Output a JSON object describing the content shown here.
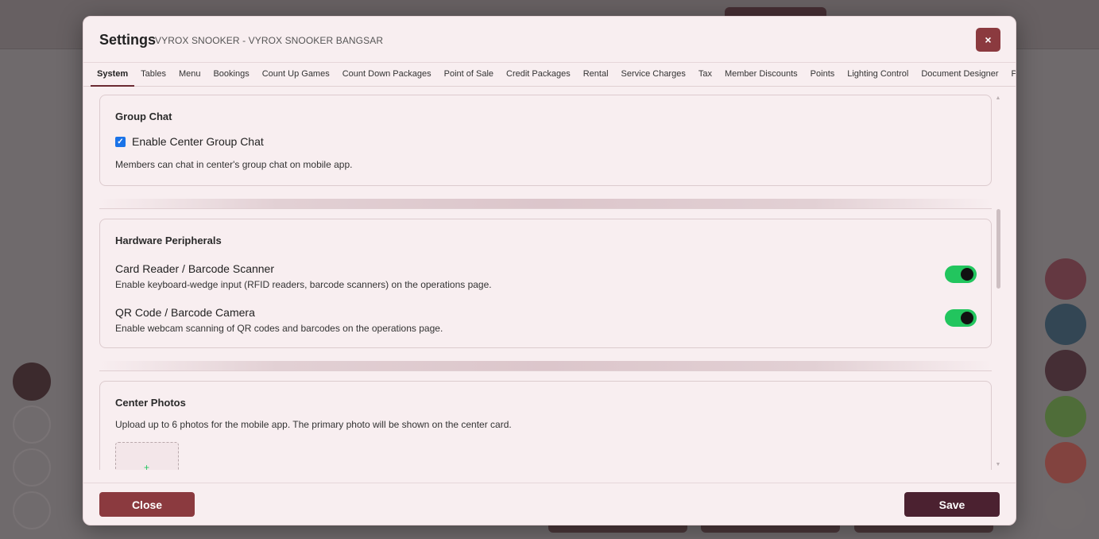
{
  "modal": {
    "title": "Settings",
    "subtitle": "VYROX SNOOKER - VYROX SNOOKER BANGSAR",
    "close_icon": "×"
  },
  "tabs": [
    {
      "label": "System",
      "active": true
    },
    {
      "label": "Tables"
    },
    {
      "label": "Menu"
    },
    {
      "label": "Bookings"
    },
    {
      "label": "Count Up Games"
    },
    {
      "label": "Count Down Packages"
    },
    {
      "label": "Point of Sale"
    },
    {
      "label": "Credit Packages"
    },
    {
      "label": "Rental"
    },
    {
      "label": "Service Charges"
    },
    {
      "label": "Tax"
    },
    {
      "label": "Member Discounts"
    },
    {
      "label": "Points"
    },
    {
      "label": "Lighting Control"
    },
    {
      "label": "Document Designer"
    },
    {
      "label": "Printers"
    }
  ],
  "group_chat": {
    "title": "Group Chat",
    "checkbox_label": "Enable Center Group Chat",
    "checked": true,
    "help": "Members can chat in center's group chat on mobile app."
  },
  "hardware": {
    "title": "Hardware Peripherals",
    "options": [
      {
        "title": "Card Reader / Barcode Scanner",
        "help": "Enable keyboard-wedge input (RFID readers, barcode scanners) on the operations page.",
        "enabled": true
      },
      {
        "title": "QR Code / Barcode Camera",
        "help": "Enable webcam scanning of QR codes and barcodes on the operations page.",
        "enabled": true
      }
    ]
  },
  "photos": {
    "title": "Center Photos",
    "help": "Upload up to 6 photos for the mobile app. The primary photo will be shown on the center card.",
    "add_icon": "+"
  },
  "footer": {
    "close_label": "Close",
    "save_label": "Save"
  },
  "colors": {
    "accent": "#8b3a3f",
    "save": "#4b2130",
    "toggle_on": "#22c55e",
    "checkbox": "#1a73e8"
  }
}
